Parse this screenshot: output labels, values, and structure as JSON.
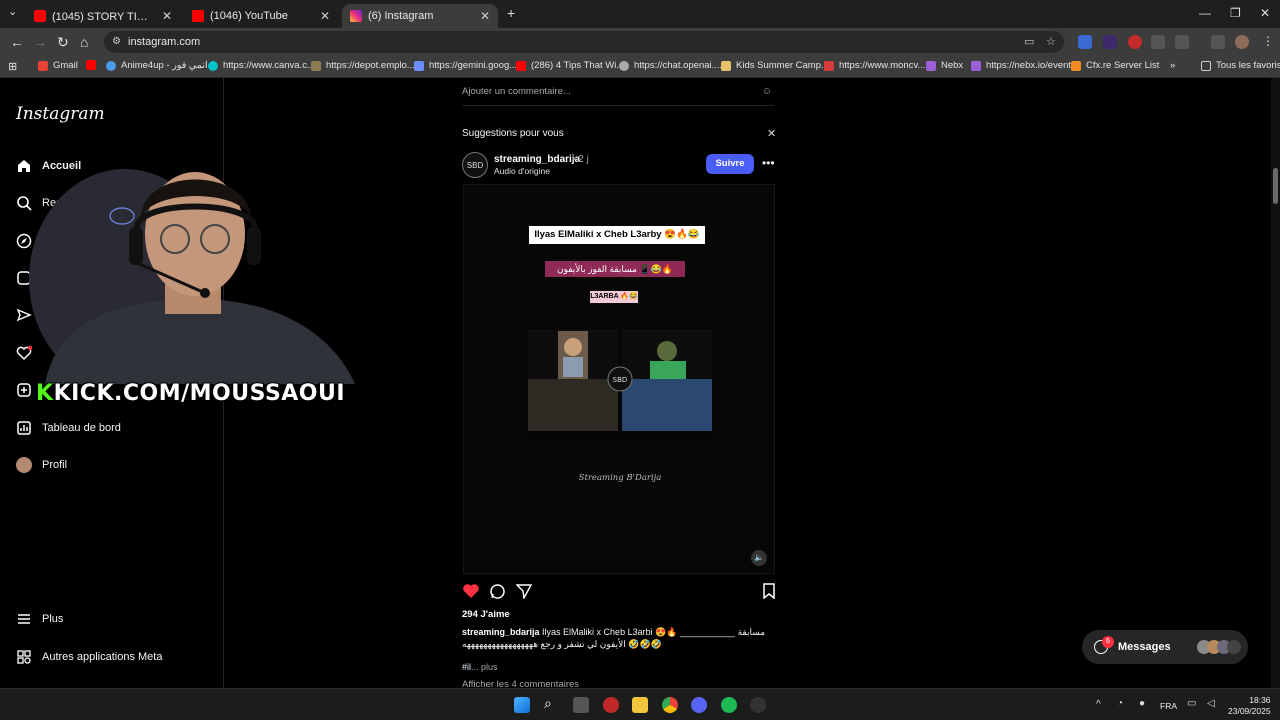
{
  "browser": {
    "tabs": [
      {
        "title": "(1045) STORY TIME || جع السحور",
        "active": false
      },
      {
        "title": "(1046) YouTube",
        "active": false
      },
      {
        "title": "(6) Instagram",
        "active": true
      }
    ],
    "new_tab": "+",
    "url": "instagram.com",
    "bookmarks": [
      "Gmail",
      "Anime4up - انمي فور...",
      "https://www.canva.c...",
      "https://depot.emplo...",
      "https://gemini.goog...",
      "(286) 4 Tips That Wi...",
      "https://chat.openai....",
      "Kids Summer Camp...",
      "https://www.moncv...",
      "Nebx",
      "https://nebx.io/event",
      "Cfx.re Server List"
    ],
    "bookmarks_overflow": "»",
    "all_favorites": "Tous les favoris"
  },
  "sidebar": {
    "logo": "Instagram",
    "items": [
      {
        "label": "Accueil",
        "icon": "home-icon",
        "bold": true
      },
      {
        "label": "Rech",
        "icon": "search-icon"
      },
      {
        "label": "Dé",
        "icon": "compass-icon"
      },
      {
        "label": "",
        "icon": "reels-icon"
      },
      {
        "label": "",
        "icon": "send-icon"
      },
      {
        "label": "",
        "icon": "heart-icon"
      },
      {
        "label": "",
        "icon": "create-icon"
      },
      {
        "label": "Tableau de bord",
        "icon": "dashboard-icon"
      },
      {
        "label": "Profil",
        "icon": "avatar"
      }
    ],
    "more": "Plus",
    "meta": "Autres applications Meta"
  },
  "feed": {
    "add_comment": "Ajouter un commentaire...",
    "suggestions_title": "Suggestions pour vous",
    "post": {
      "username": "streaming_bdarija",
      "time": "• 2 j",
      "audio": "Audio d'origine",
      "follow_label": "Suivre",
      "video_title": "Ilyas ElMaliki x Cheb L3arby 😍🔥😂",
      "video_arabic": "مسابقة الفوز بالأيفون 📱😂🔥",
      "video_tag": "L3ARBA 🔥😂",
      "video_watermark": "Streaming B'Darija",
      "likes": "294 J'aime",
      "caption_user": "streaming_bdarija",
      "caption_text": "Ilyas ElMaliki x Cheb L3arbi 😍🔥 ___________ مسابقة الأيفون لي تشفر و رجع هههههههههههههههههه 🤣🤣🤣",
      "caption_hash": "#il",
      "more_label": "... plus",
      "view_comments": "Afficher les 4 commentaires"
    }
  },
  "messages": {
    "label": "Messages",
    "badge": "6"
  },
  "overlay": {
    "kick_prefix": "K",
    "kick_text": "KICK.COM/MOUSSAOUI"
  },
  "taskbar": {
    "lang": "FRA",
    "time": "18:36",
    "date": "23/09/2025"
  },
  "colors": {
    "follow": "#4a5df9",
    "like": "#ff3040",
    "kick": "#53fc18"
  }
}
